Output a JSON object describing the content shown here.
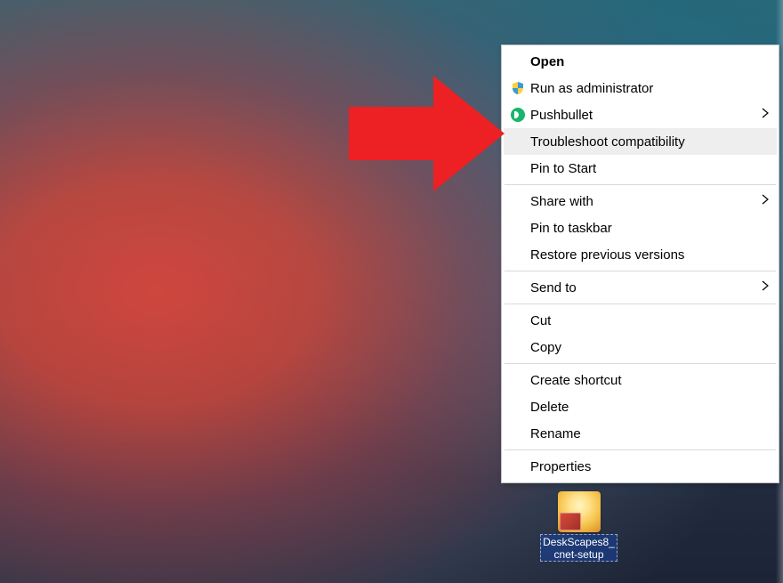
{
  "desktop": {
    "icon_label": "DeskScapes8_\ncnet-setup"
  },
  "context_menu": {
    "groups": [
      [
        {
          "label": "Open",
          "bold": true,
          "icon": "",
          "arrow": false
        },
        {
          "label": "Run as administrator",
          "bold": false,
          "icon": "shield",
          "arrow": false
        },
        {
          "label": "Pushbullet",
          "bold": false,
          "icon": "pushbullet",
          "arrow": true
        },
        {
          "label": "Troubleshoot compatibility",
          "bold": false,
          "icon": "",
          "arrow": false,
          "highlight": true
        },
        {
          "label": "Pin to Start",
          "bold": false,
          "icon": "",
          "arrow": false
        }
      ],
      [
        {
          "label": "Share with",
          "bold": false,
          "icon": "",
          "arrow": true
        },
        {
          "label": "Pin to taskbar",
          "bold": false,
          "icon": "",
          "arrow": false
        },
        {
          "label": "Restore previous versions",
          "bold": false,
          "icon": "",
          "arrow": false
        }
      ],
      [
        {
          "label": "Send to",
          "bold": false,
          "icon": "",
          "arrow": true
        }
      ],
      [
        {
          "label": "Cut",
          "bold": false,
          "icon": "",
          "arrow": false
        },
        {
          "label": "Copy",
          "bold": false,
          "icon": "",
          "arrow": false
        }
      ],
      [
        {
          "label": "Create shortcut",
          "bold": false,
          "icon": "",
          "arrow": false
        },
        {
          "label": "Delete",
          "bold": false,
          "icon": "",
          "arrow": false
        },
        {
          "label": "Rename",
          "bold": false,
          "icon": "",
          "arrow": false
        }
      ],
      [
        {
          "label": "Properties",
          "bold": false,
          "icon": "",
          "arrow": false
        }
      ]
    ]
  },
  "arrow": {
    "color": "#ed2024"
  }
}
